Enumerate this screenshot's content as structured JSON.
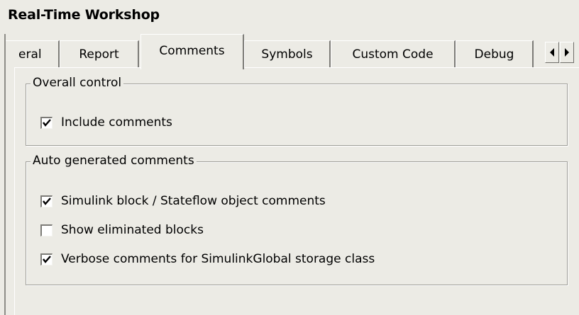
{
  "window": {
    "title": "Real-Time Workshop"
  },
  "tabs": [
    {
      "label": "eral",
      "active": false
    },
    {
      "label": "Report",
      "active": false
    },
    {
      "label": "Comments",
      "active": true
    },
    {
      "label": "Symbols",
      "active": false
    },
    {
      "label": "Custom Code",
      "active": false
    },
    {
      "label": "Debug",
      "active": false
    }
  ],
  "tab_scroll": {
    "left_icon": "arrow-left-icon",
    "right_icon": "arrow-right-icon"
  },
  "overall_control": {
    "legend": "Overall control",
    "include_comments": {
      "label": "Include comments",
      "checked": true
    }
  },
  "auto_generated": {
    "legend": "Auto generated comments",
    "items": [
      {
        "label": "Simulink block / Stateflow object comments",
        "checked": true
      },
      {
        "label": "Show eliminated blocks",
        "checked": false
      },
      {
        "label": "Verbose comments for SimulinkGlobal storage class",
        "checked": true
      }
    ]
  }
}
